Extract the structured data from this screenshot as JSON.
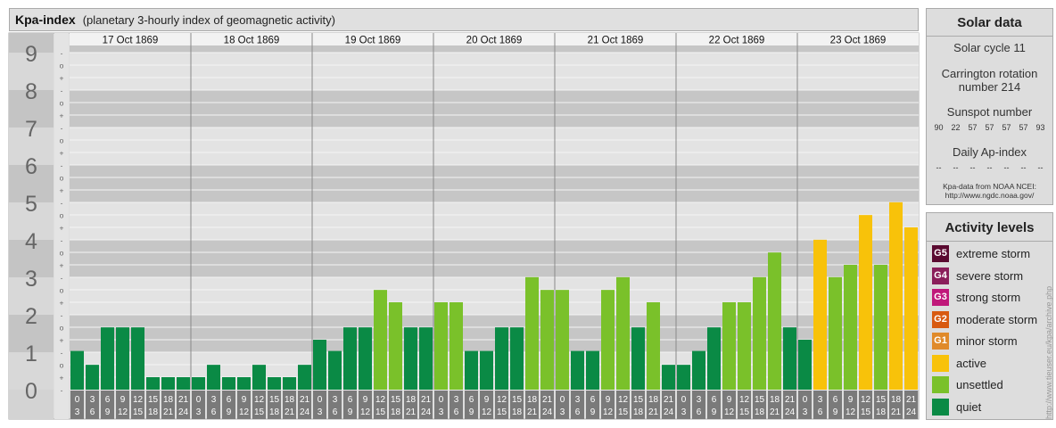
{
  "header": {
    "title": "Kpa-index",
    "subtitle": "(planetary 3-hourly index of geomagnetic activity)"
  },
  "chart_data": {
    "type": "bar",
    "y_tick_labels": [
      "0",
      "1",
      "2",
      "3",
      "4",
      "5",
      "6",
      "7",
      "8",
      "9"
    ],
    "ylim": [
      0,
      9
    ],
    "subdivision_marks": [
      "-",
      "+",
      "o"
    ],
    "days": [
      "17 Oct 1869",
      "18 Oct 1869",
      "19 Oct 1869",
      "20 Oct 1869",
      "21 Oct 1869",
      "22 Oct 1869",
      "23 Oct 1869"
    ],
    "interval_start_labels": [
      "0",
      "3",
      "6",
      "9",
      "12",
      "15",
      "18",
      "21"
    ],
    "interval_end_labels": [
      "3",
      "6",
      "9",
      "12",
      "15",
      "18",
      "21",
      "24"
    ],
    "values": [
      [
        0.7,
        0.33,
        1.33,
        1.33,
        1.33,
        0,
        0,
        0
      ],
      [
        0,
        0.33,
        0,
        0,
        0.33,
        0,
        0,
        0.33
      ],
      [
        1,
        0.7,
        1.33,
        1.33,
        2.33,
        2,
        1.33,
        1.33
      ],
      [
        2,
        2,
        0.7,
        0.7,
        1.33,
        1.33,
        2.67,
        2.33
      ],
      [
        2.33,
        0.7,
        0.7,
        2.33,
        2.67,
        1.33,
        2,
        0.33
      ],
      [
        0.33,
        0.7,
        1.33,
        2,
        2,
        2.67,
        3.33,
        1.33
      ],
      [
        1,
        3.67,
        2.67,
        3,
        4.33,
        3,
        4.67,
        4
      ]
    ],
    "colors": {
      "quiet": "#0a8a45",
      "unsettled": "#7ac12a",
      "active": "#f8c20a",
      "G1": "#e08a2a",
      "G2": "#d85a10",
      "G3": "#c0187a",
      "G4": "#8a1e5a",
      "G5": "#5a0a30"
    }
  },
  "solar": {
    "title": "Solar data",
    "cycle": "Solar cycle 11",
    "carrington_line1": "Carrington rotation",
    "carrington_line2": "number 214",
    "sunspot_title": "Sunspot number",
    "sunspot_values": [
      "90",
      "22",
      "57",
      "57",
      "57",
      "57",
      "93"
    ],
    "ap_title": "Daily Ap-index",
    "ap_values": [
      "--",
      "--",
      "--",
      "--",
      "--",
      "--",
      "--"
    ],
    "credit_line1": "Kpa-data from NOAA NCEI:",
    "credit_line2": "http://www.ngdc.noaa.gov/"
  },
  "levels": {
    "title": "Activity levels",
    "items": [
      {
        "badge": "G5",
        "label": "extreme storm",
        "color": "#5a0a30"
      },
      {
        "badge": "G4",
        "label": "severe storm",
        "color": "#8a1e5a"
      },
      {
        "badge": "G3",
        "label": "strong storm",
        "color": "#c0187a"
      },
      {
        "badge": "G2",
        "label": "moderate storm",
        "color": "#d85a10"
      },
      {
        "badge": "G1",
        "label": "minor storm",
        "color": "#e08a2a"
      },
      {
        "badge": "",
        "label": "active",
        "color": "#f8c20a"
      },
      {
        "badge": "",
        "label": "unsettled",
        "color": "#7ac12a"
      },
      {
        "badge": "",
        "label": "quiet",
        "color": "#0a8a45"
      }
    ]
  },
  "watermark": "http://www.tieuser.eu/kpa/archive.php"
}
